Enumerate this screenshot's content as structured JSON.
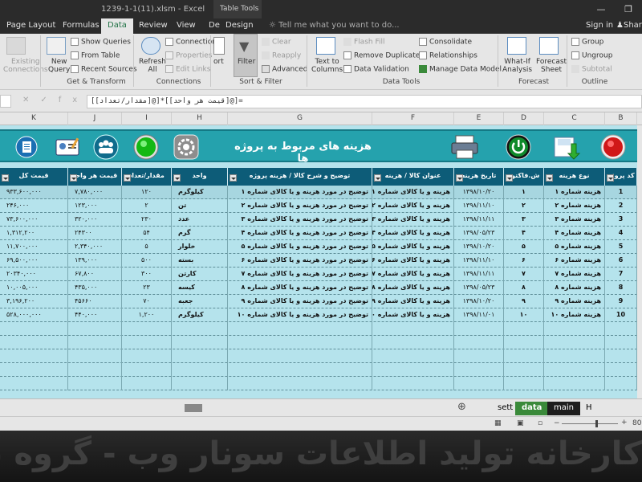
{
  "window": {
    "title": "1239-1-1(11).xlsm - Excel",
    "context_tab": "Table Tools"
  },
  "tabs": [
    "Page Layout",
    "Formulas",
    "Data",
    "Review",
    "View",
    "De",
    "Design"
  ],
  "active_tab": "Data",
  "tell_me": "Tell me what you want to do...",
  "sign_in": "Sign in",
  "share": "Share",
  "ribbon": {
    "existing": [
      "Existing",
      "Connections"
    ],
    "new_query": [
      "New",
      "Query"
    ],
    "show_queries": "Show Queries",
    "from_table": "From Table",
    "recent_sources": "Recent Sources",
    "refresh": [
      "Refresh",
      "All"
    ],
    "connections": "Connections",
    "properties": "Properties",
    "edit_links": "Edit Links",
    "sort": "ort",
    "filter": "Filter",
    "clear": "Clear",
    "reapply": "Reapply",
    "advanced": "Advanced",
    "text_to_columns": [
      "Text to",
      "Columns"
    ],
    "flash_fill": "Flash Fill",
    "remove_duplicates": "Remove Duplicates",
    "data_validation": "Data Validation",
    "consolidate": "Consolidate",
    "relationships": "Relationships",
    "manage_data_model": "Manage Data Model",
    "what_if": [
      "What-If",
      "Analysis"
    ],
    "forecast_sheet": [
      "Forecast",
      "Sheet"
    ],
    "group": "Group",
    "ungroup": "Ungroup",
    "subtotal": "Subtotal",
    "groups": [
      "Get & Transform",
      "Connections",
      "Sort & Filter",
      "Data Tools",
      "Forecast",
      "Outline"
    ]
  },
  "formula_bar": {
    "formula": "=[@[قیمت هر واحد]]*[@[مقدار/تعداد]]",
    "fx": "fx"
  },
  "columns": [
    "K",
    "J",
    "I",
    "H",
    "G",
    "F",
    "E",
    "D",
    "C",
    "B"
  ],
  "banner_title": "هزینه های مربوط به پروژه ها",
  "headers": [
    "قیمت کل",
    "قیمت هر واحد",
    "مقدار/تعداد",
    "واحد",
    "توضیح و شرح کالا / هزینه پروژه",
    "عنوان کالا / هزینه",
    "تاریخ هزینه",
    "ش.فاکتور",
    "نوع هزینه",
    "کد پروژه"
  ],
  "rows": [
    [
      "۹۳۳,۶۰۰,۰۰۰",
      "۷,۷۸۰,۰۰۰",
      "۱۲۰",
      "کیلوگرم",
      "توضیح در مورد هزینه و یا کالای شماره ۱",
      "هزینه و یا کالای شماره ۱",
      "۱۳۹۸/۱۰/۲۰",
      "۱",
      "هزینه شماره ۱",
      "1"
    ],
    [
      "۲۴۶,۰۰۰",
      "۱۲۳,۰۰۰",
      "۲",
      "تن",
      "توضیح در مورد هزینه و یا کالای شماره ۲",
      "هزینه و یا کالای شماره ۲",
      "۱۳۹۸/۱۱/۱۰",
      "۲",
      "هزینه شماره ۲",
      "2"
    ],
    [
      "۷۳,۶۰۰,۰۰۰",
      "۳۲۰,۰۰۰",
      "۲۳۰",
      "عدد",
      "توضیح در مورد هزینه و یا کالای شماره ۳",
      "هزینه و یا کالای شماره ۳",
      "۱۳۹۸/۱۱/۱۱",
      "۳",
      "هزینه شماره ۳",
      "3"
    ],
    [
      "۱,۳۱۲,۲۰۰",
      "۲۴۳۰۰",
      "۵۴",
      "گرم",
      "توضیح در مورد هزینه و یا کالای شماره ۴",
      "هزینه و یا کالای شماره ۴",
      "۱۳۹۸/۰۵/۲۳",
      "۴",
      "هزینه شماره ۴",
      "4"
    ],
    [
      "۱۱,۷۰۰,۰۰۰",
      "۲,۳۴۰,۰۰۰",
      "۵",
      "خلوار",
      "توضیح در مورد هزینه و یا کالای شماره ۵",
      "هزینه و یا کالای شماره ۵",
      "۱۳۹۸/۱۰/۲۰",
      "۵",
      "هزینه شماره ۵",
      "5"
    ],
    [
      "۶۹,۵۰۰,۰۰۰",
      "۱۳۹,۰۰۰",
      "۵۰۰",
      "بسته",
      "توضیح در مورد هزینه و یا کالای شماره ۶",
      "هزینه و یا کالای شماره ۶",
      "۱۳۹۸/۱۱/۱۰",
      "۶",
      "هزینه شماره ۶",
      "6"
    ],
    [
      "۲۰۳۴۰,۰۰۰",
      "۶۷,۸۰۰",
      "۳۰۰",
      "کارتن",
      "توضیح در مورد هزینه و یا کالای شماره ۷",
      "هزینه و یا کالای شماره ۷",
      "۱۳۹۸/۱۱/۱۱",
      "۷",
      "هزینه شماره ۷",
      "7"
    ],
    [
      "۱۰,۰۰۵,۰۰۰",
      "۴۳۵,۰۰۰",
      "۲۳",
      "کیسه",
      "توضیح در مورد هزینه و یا کالای شماره ۸",
      "هزینه و یا کالای شماره ۸",
      "۱۳۹۸/۰۵/۲۳",
      "۸",
      "هزینه شماره ۸",
      "8"
    ],
    [
      "۳,۱۹۶,۲۰۰",
      "۴۵۶۶۰",
      "۷۰",
      "جعبه",
      "توضیح در مورد هزینه و یا کالای شماره ۹",
      "هزینه و یا کالای شماره ۹",
      "۱۳۹۸/۱۰/۲۰",
      "۹",
      "هزینه شماره ۹",
      "9"
    ],
    [
      "۵۲۸,۰۰۰,۰۰۰",
      "۴۴۰,۰۰۰",
      "۱,۲۰۰",
      "کیلوگرم",
      "توضیح در مورد هزینه و یا کالای شماره ۱۰",
      "هزینه و یا کالای شماره ۱۰",
      "۱۳۹۸/۱۱/۰۱",
      "۱۰",
      "هزینه شماره ۱۰",
      "10"
    ]
  ],
  "sheet_tabs": [
    "sett",
    "data",
    "main",
    "H"
  ],
  "active_sheet": "data",
  "zoom": "80",
  "footer_text": "کارخانه تولید اطلاعات سونار وب - گروه نرم افزاری آریان"
}
